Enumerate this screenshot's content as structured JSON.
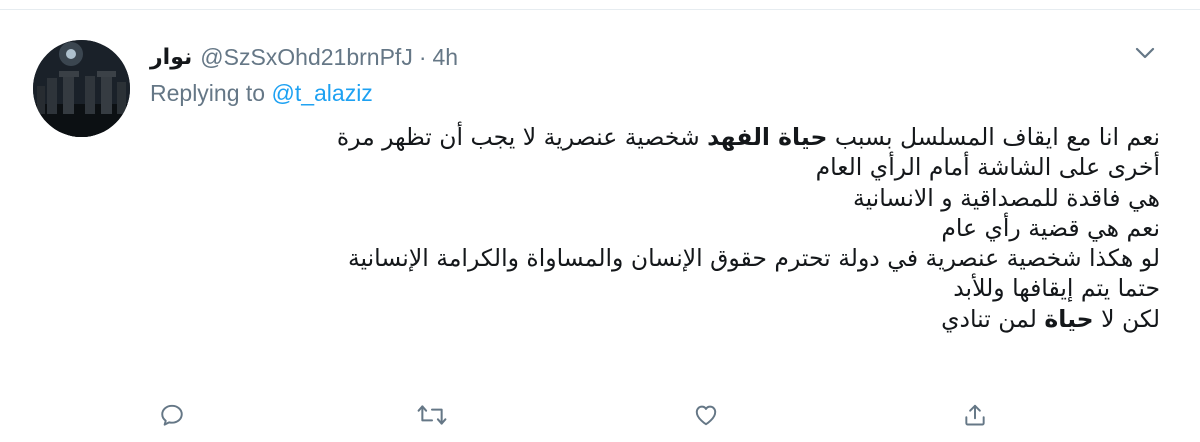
{
  "tweet": {
    "display_name": "نوار",
    "handle": "@SzSxOhd21brnPfJ",
    "separator": "·",
    "time": "4h",
    "replying_prefix": "Replying to",
    "replying_to": "@t_alaziz",
    "lines": [
      {
        "before": "نعم انا مع ايقاف المسلسل بسبب ",
        "bold": "حياة الفهد",
        "after": " شخصية عنصرية لا يجب أن تظهر مرة"
      },
      {
        "before": "أخرى على الشاشة أمام الرأي العام",
        "bold": "",
        "after": ""
      },
      {
        "before": "هي فاقدة للمصداقية و الانسانية",
        "bold": "",
        "after": ""
      },
      {
        "before": "نعم هي قضية رأي عام",
        "bold": "",
        "after": ""
      },
      {
        "before": "لو هكذا شخصية عنصرية في دولة تحترم حقوق الإنسان والمساواة والكرامة الإنسانية",
        "bold": "",
        "after": ""
      },
      {
        "before": "حتما يتم إيقافها وللأبد",
        "bold": "",
        "after": ""
      },
      {
        "before": "لكن لا ",
        "bold": "حياة",
        "after": " لمن تنادي"
      }
    ]
  },
  "actions": {
    "reply_icon": "reply-icon",
    "retweet_icon": "retweet-icon",
    "like_icon": "heart-icon",
    "share_icon": "share-icon"
  },
  "colors": {
    "text": "#14171a",
    "muted": "#657786",
    "link": "#1da1f2"
  }
}
